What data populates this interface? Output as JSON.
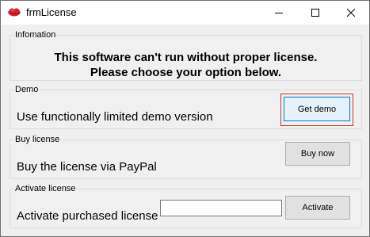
{
  "window": {
    "title": "frmLicense",
    "icon": "red-lips-app-icon"
  },
  "titlebar_buttons": {
    "minimize": "minimize-icon",
    "maximize": "maximize-icon",
    "close": "close-icon"
  },
  "information": {
    "legend": "Infomation",
    "line1": "This software can't run without proper license.",
    "line2": "Please choose your option below."
  },
  "demo": {
    "legend": "Demo",
    "description": "Use functionally limited demo version",
    "button_label": "Get demo"
  },
  "buy": {
    "legend": "Buy license",
    "description": "Buy the license via PayPal",
    "button_label": "Buy now"
  },
  "activate": {
    "legend": "Activate license",
    "description": "Activate purchased license",
    "input_value": "",
    "button_label": "Activate"
  },
  "colors": {
    "focus_ring": "#c0392b",
    "focused_button_border": "#0078d7",
    "app_icon": "#d9262c"
  }
}
